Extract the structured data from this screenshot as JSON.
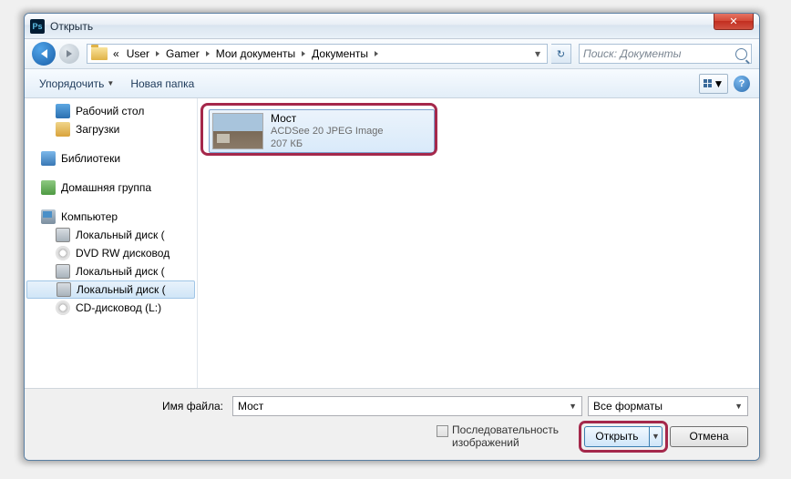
{
  "title": "Открыть",
  "breadcrumbs": {
    "prefix": "«",
    "b0": "User",
    "b1": "Gamer",
    "b2": "Мои документы",
    "b3": "Документы"
  },
  "search": {
    "placeholder": "Поиск: Документы"
  },
  "toolbar": {
    "organize": "Упорядочить",
    "newfolder": "Новая папка"
  },
  "tree": {
    "desktop": "Рабочий стол",
    "downloads": "Загрузки",
    "libraries": "Библиотеки",
    "homegroup": "Домашняя группа",
    "computer": "Компьютер",
    "hdd1": "Локальный диск (",
    "dvd": "DVD RW дисковод",
    "hdd2": "Локальный диск (",
    "hdd3": "Локальный диск (",
    "cd": "CD-дисковод (L:)"
  },
  "file": {
    "name": "Мост",
    "type": "ACDSee 20 JPEG Image",
    "size": "207 КБ"
  },
  "footer": {
    "filename_label": "Имя файла:",
    "filename_value": "Мост",
    "filetype": "Все форматы",
    "sequence_l1": "Последовательность",
    "sequence_l2": "изображений",
    "open": "Открыть",
    "cancel": "Отмена"
  }
}
